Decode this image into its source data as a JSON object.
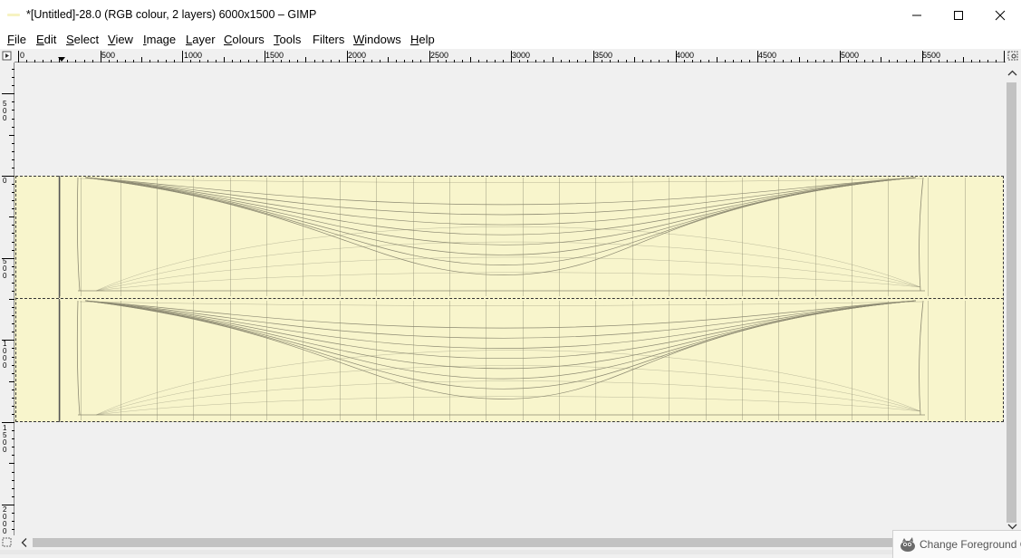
{
  "window": {
    "title": "*[Untitled]-28.0 (RGB colour, 2 layers) 6000x1500 – GIMP"
  },
  "menu": [
    {
      "label": "File",
      "mnemonic": "F",
      "rest": "ile"
    },
    {
      "label": "Edit",
      "mnemonic": "E",
      "rest": "dit"
    },
    {
      "label": "Select",
      "mnemonic": "S",
      "rest": "elect"
    },
    {
      "label": "View",
      "mnemonic": "V",
      "rest": "iew"
    },
    {
      "label": "Image",
      "mnemonic": "I",
      "rest": "mage"
    },
    {
      "label": "Layer",
      "mnemonic": "L",
      "rest": "ayer"
    },
    {
      "label": "Colours",
      "mnemonic": "C",
      "rest": "olours"
    },
    {
      "label": "Tools",
      "mnemonic": "T",
      "rest": "ools"
    },
    {
      "label": "Filters",
      "mnemonic": "",
      "rest": "Filters"
    },
    {
      "label": "Windows",
      "mnemonic": "W",
      "rest": "indows"
    },
    {
      "label": "Help",
      "mnemonic": "H",
      "rest": "elp"
    }
  ],
  "ruler_top_labels": [
    "0",
    "500",
    "1000",
    "1500",
    "2000",
    "2500",
    "3000",
    "3500",
    "4000",
    "4500",
    "5000",
    "5500"
  ],
  "ruler_left_labels": [
    "500",
    "0",
    "500",
    "1000",
    "1500",
    "2000"
  ],
  "toast": {
    "text": "Change Foreground C"
  },
  "colors": {
    "canvas_fill": "#f8f5cc",
    "workspace": "#f0f0f0",
    "selection": "#333333",
    "drawing_lines": "#8d8a72"
  },
  "icons": {
    "app": "gimp-wilber-icon",
    "minimize": "minimize-icon",
    "maximize": "maximize-icon",
    "close": "close-icon",
    "ruler_toggle": "quickmask-toggle-icon",
    "navigate": "navigate-icon",
    "scroll_up": "chevron-up-icon",
    "scroll_down": "chevron-down-icon",
    "scroll_left": "chevron-left-icon"
  }
}
